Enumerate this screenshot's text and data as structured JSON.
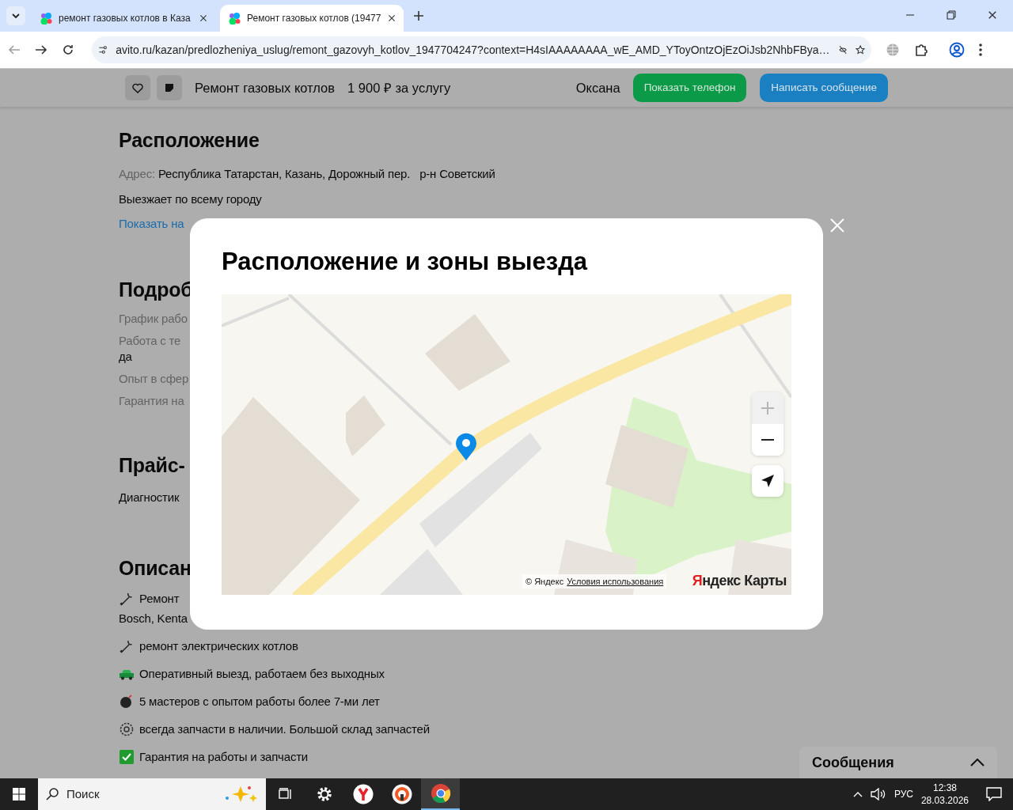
{
  "browser": {
    "tabs": [
      {
        "title": "ремонт газовых котлов в Каза",
        "selected": false
      },
      {
        "title": "Ремонт газовых котлов (19477",
        "selected": true
      }
    ],
    "back_disabled": true,
    "address": "avito.ru/kazan/predlozheniya_uslug/remont_gazovyh_kotlov_1947704247?context=H4sIAAAAAAAA_wE_AMD_YToyOntzOjEzOiJsb2NhbFBya…"
  },
  "header": {
    "title": "Ремонт газовых котлов",
    "price": "1 900 ₽ за услугу",
    "seller": "Оксана",
    "phone_button": "Показать телефон",
    "message_button": "Написать сообщение"
  },
  "location": {
    "heading": "Расположение",
    "address_label": "Адрес:",
    "address": "Республика Татарстан, Казань, Дорожный пер.",
    "district": "р-н Советский",
    "travel": "Выезжает по всему городу",
    "map_link": "Показать на"
  },
  "details": {
    "heading": "Подроб",
    "rows": [
      {
        "label": "График рабо"
      },
      {
        "label": "Работа с те",
        "value": "да"
      },
      {
        "label": "Опыт в сфер"
      },
      {
        "label": "Гарантия на"
      }
    ]
  },
  "prices": {
    "heading": "Прайс-",
    "rows": [
      "Диагностик"
    ]
  },
  "description": {
    "heading": "Описан",
    "items": [
      {
        "kind": "wrench",
        "text": "Ремонт",
        "continuation": "Bosch, Kenta"
      },
      {
        "kind": "wrench",
        "text": "ремонт электрических котлов"
      },
      {
        "kind": "car",
        "text": "Оперативный выезд, работаем без выходных"
      },
      {
        "kind": "bomb",
        "text": "5 мастеров с опытом работы более 7-ми лет"
      },
      {
        "kind": "gear",
        "text": "всегда запчасти в наличии. Большой склад запчастей"
      },
      {
        "kind": "check",
        "text": "Гарантия на работы и запчасти"
      }
    ]
  },
  "modal": {
    "title": "Расположение и зоны выезда",
    "map": {
      "kind": "picture",
      "zoom_in_disabled": true,
      "attribution": "© Яндекс",
      "terms": "Условия использования",
      "logo": "Яндекс Карты"
    }
  },
  "messages": {
    "title": "Сообщения"
  },
  "taskbar": {
    "search_placeholder": "Поиск",
    "language": "РУС",
    "time": "12:38",
    "date": "28.03.2026"
  }
}
